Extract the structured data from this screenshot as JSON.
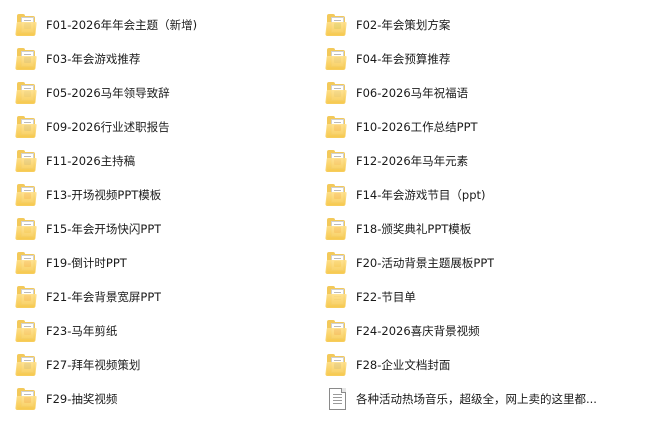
{
  "items": [
    {
      "name": "F01-2026年年会主题（新增)",
      "icon": "folder-icon",
      "badge": "#8fa9d8"
    },
    {
      "name": "F02-年会策划方案",
      "icon": "folder-icon",
      "badge": "#2e9e55"
    },
    {
      "name": "F03-年会游戏推荐",
      "icon": "folder-icon",
      "badge": "#3a6fd6"
    },
    {
      "name": "F04-年会预算推荐",
      "icon": "folder-icon",
      "badge": "#8fa9d8"
    },
    {
      "name": "F05-2026马年领导致辞",
      "icon": "folder-icon",
      "badge": "#8fa9d8"
    },
    {
      "name": "F06-2026马年祝福语",
      "icon": "folder-icon",
      "badge": "#8fa9d8"
    },
    {
      "name": "F09-2026行业述职报告",
      "icon": "folder-icon",
      "badge": "#3a6fd6"
    },
    {
      "name": "F10-2026工作总结PPT",
      "icon": "folder-icon",
      "badge": "#d9482b"
    },
    {
      "name": "F11-2026主持稿",
      "icon": "folder-icon",
      "badge": "#3a6fd6"
    },
    {
      "name": "F12-2026年马年元素",
      "icon": "folder-icon",
      "badge": "#e07a7a"
    },
    {
      "name": "F13-开场视频PPT模板",
      "icon": "folder-icon",
      "badge": "#d9482b"
    },
    {
      "name": "F14-年会游戏节目（ppt)",
      "icon": "folder-icon",
      "badge": "#d9482b"
    },
    {
      "name": "F15-年会开场快闪PPT",
      "icon": "folder-icon",
      "badge": "#d9a52b"
    },
    {
      "name": "F18-颁奖典礼PPT模板",
      "icon": "folder-icon",
      "badge": "#d9482b"
    },
    {
      "name": "F19-倒计时PPT",
      "icon": "folder-icon",
      "badge": "#d9482b"
    },
    {
      "name": "F20-活动背景主题展板PPT",
      "icon": "folder-icon",
      "badge": "#d9a52b"
    },
    {
      "name": "F21-年会背景宽屏PPT",
      "icon": "folder-icon",
      "badge": "#d9482b"
    },
    {
      "name": "F22-节目单",
      "icon": "folder-icon",
      "badge": ""
    },
    {
      "name": "F23-马年剪纸",
      "icon": "folder-icon",
      "badge": "#e07a7a"
    },
    {
      "name": "F24-2026喜庆背景视频",
      "icon": "folder-icon",
      "badge": "#c8282b"
    },
    {
      "name": "F27-拜年视频策划",
      "icon": "folder-icon",
      "badge": "#3a6fd6"
    },
    {
      "name": "F28-企业文档封面",
      "icon": "folder-icon",
      "badge": "#3a6fd6"
    },
    {
      "name": "F29-抽奖视频",
      "icon": "folder-icon",
      "badge": "#c8282b"
    },
    {
      "name": "各种活动热场音乐，超级全，网上卖的这里都...",
      "icon": "text-file-icon",
      "badge": ""
    }
  ]
}
